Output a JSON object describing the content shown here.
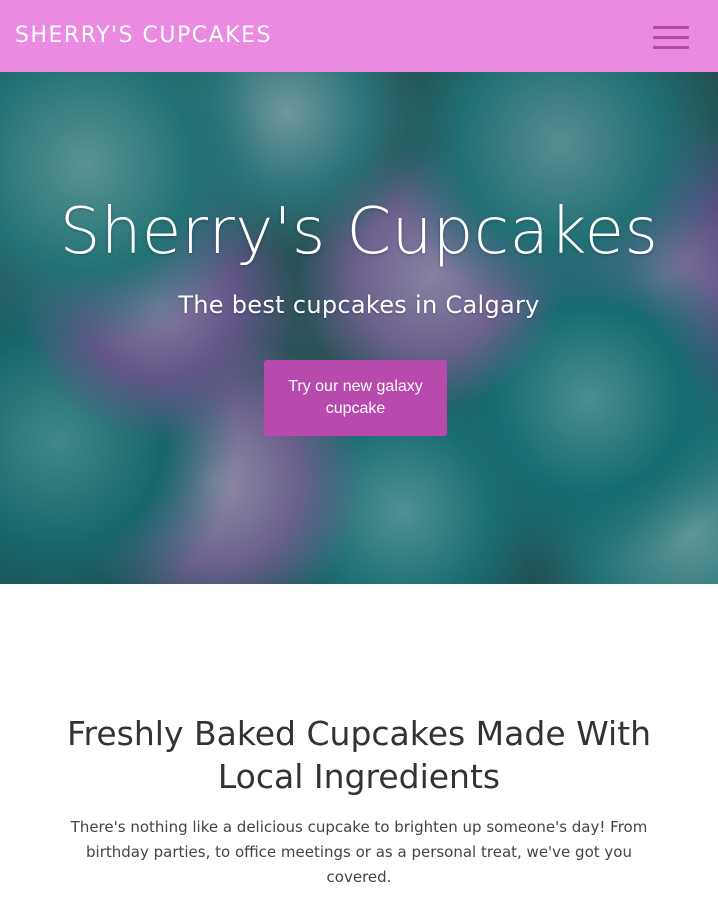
{
  "navbar": {
    "brand": "SHERRY'S CUPCAKES",
    "menu_icon": "hamburger-menu-icon",
    "background_color": "#ea8ae0",
    "menu_icon_color": "#b14aa6"
  },
  "hero": {
    "title": "Sherry's Cupcakes",
    "subtitle": "The best cupcakes in Calgary",
    "cta_label": "Try our new galaxy cupcake",
    "cta_color": "#b84aad"
  },
  "intro": {
    "heading": "Freshly Baked Cupcakes Made With Local Ingredients",
    "text": "There's nothing like a delicious cupcake to brighten up someone's day! From birthday parties, to office meetings or as a personal treat, we've got you covered."
  }
}
